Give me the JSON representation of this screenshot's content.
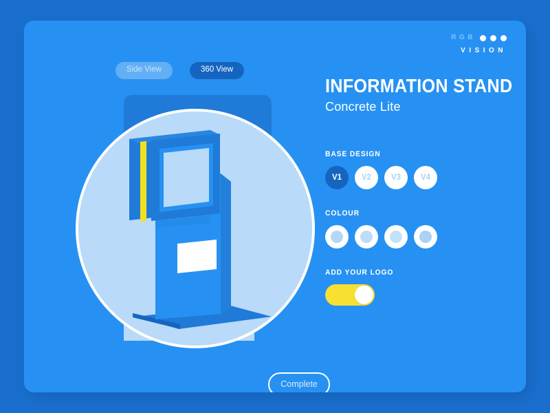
{
  "brand": {
    "primary_text": "RGB",
    "secondary_text": "VISION",
    "dot_count": 3
  },
  "view_tabs": [
    {
      "label": "Side View",
      "state": "inactive"
    },
    {
      "label": "360 View",
      "state": "active"
    }
  ],
  "product": {
    "title": "INFORMATION STAND",
    "subtitle": "Concrete Lite"
  },
  "base_design": {
    "label": "BASE DESIGN",
    "options": [
      {
        "label": "V1",
        "selected": true
      },
      {
        "label": "V2",
        "selected": false
      },
      {
        "label": "V3",
        "selected": false
      },
      {
        "label": "V4",
        "selected": false
      }
    ]
  },
  "colour": {
    "label": "COLOUR",
    "options": [
      {
        "swatch_color": "#b3d8f7"
      },
      {
        "swatch_color": "#bcddf8"
      },
      {
        "swatch_color": "#c3e1f9"
      },
      {
        "swatch_color": "#a9d2f5"
      }
    ]
  },
  "add_logo": {
    "label": "ADD YOUR LOGO",
    "enabled": true,
    "track_color": "#f8e032",
    "knob_color": "#ffffff"
  },
  "actions": {
    "complete_label": "Complete"
  },
  "theme": {
    "page_background": "#1a6fce",
    "card_background": "#2691f2",
    "accent_dark_blue": "#1565c0",
    "stage_fill": "#b9daf8",
    "highlight_yellow": "#f8e032"
  },
  "illustration": {
    "subject": "information-stand-kiosk",
    "screen_fill": "#b9daf8",
    "body_fill": "#2691f2",
    "frame_fill": "#1f7ad8",
    "stripe_fill": "#f5e020",
    "shadow_fill": "#1565c0"
  }
}
